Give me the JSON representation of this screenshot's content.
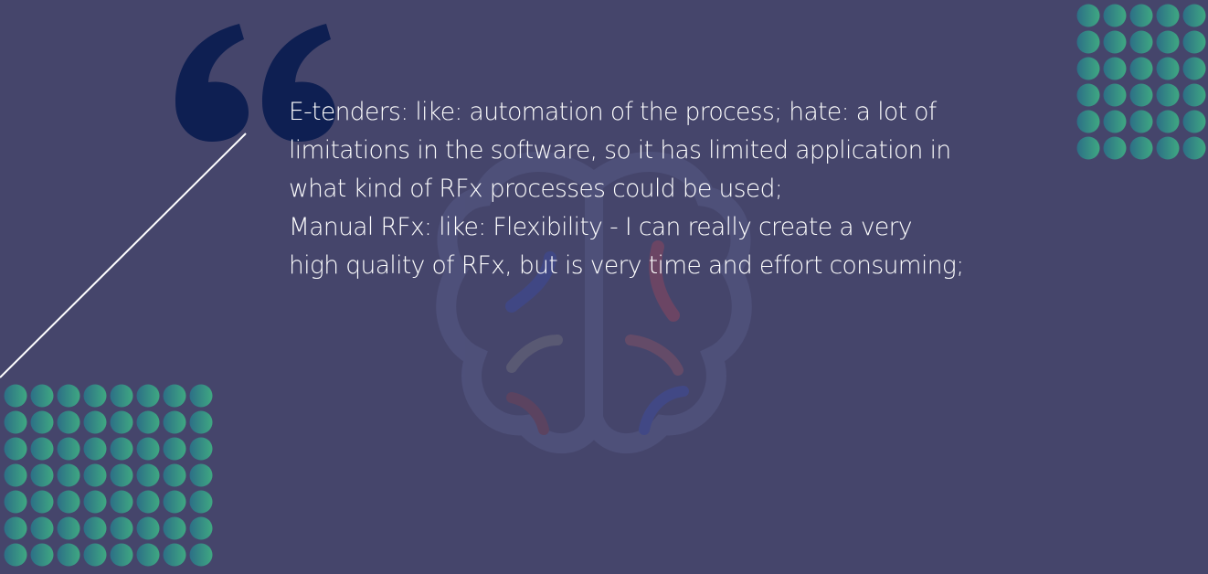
{
  "slide": {
    "background_color": "#45456b",
    "quote_mark_color": "#0e1f52",
    "dot_color_light": "#3fa882",
    "dot_color_dark": "#2c6f86",
    "quote_lines": [
      "E-tenders: like: automation of the process; hate: a lot of",
      "limitations in the software, so it has limited application in",
      "what kind of  RFx processes could be used;",
      "Manual  RFx: like:  Flexibility -  I can really create a very",
      "high quality of  RFx, but is very time and effort consuming;"
    ],
    "icons": {
      "quote_mark": "open-quote-icon",
      "brain": "brain-icon",
      "dots": "dot-grid-pattern"
    }
  }
}
